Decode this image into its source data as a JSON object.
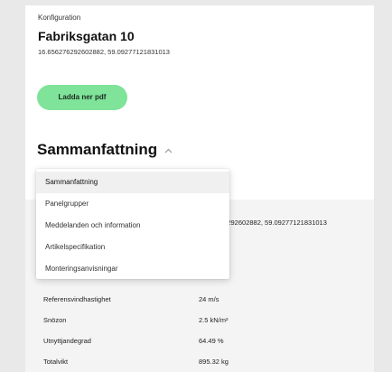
{
  "config": {
    "overline": "Konfiguration",
    "title": "Fabriksgatan 10",
    "coordinates": "16.656276292602882, 59.09277121831013",
    "pdf_button": "Ladda ner pdf"
  },
  "section": {
    "title": "Sammanfattning",
    "chevron_icon": "chevron-up-icon"
  },
  "dropdown": {
    "items": [
      {
        "label": "Sammanfattning",
        "selected": true
      },
      {
        "label": "Panelgrupper"
      },
      {
        "label": "Meddelanden och information"
      },
      {
        "label": "Artikelspecifikation"
      },
      {
        "label": "Monteringsanvisningar"
      }
    ]
  },
  "summary": {
    "peek_coordinates": "76292602882, 59.09277121831013",
    "rows": [
      {
        "label": "Referensvindhastighet",
        "value": "24 m/s"
      },
      {
        "label": "Snözon",
        "value": "2.5 kN/m²"
      },
      {
        "label": "Utnyttjandegrad",
        "value": "64.49 %"
      },
      {
        "label": "Totalvikt",
        "value": "895.32 kg"
      }
    ]
  },
  "colors": {
    "accent_green": "#7fe39a",
    "page_bg": "#e9e9e9",
    "panel_gray": "#f4f4f4"
  }
}
